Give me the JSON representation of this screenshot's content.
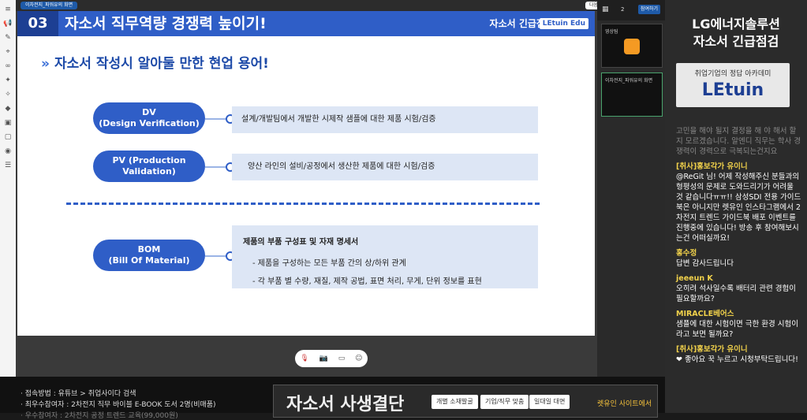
{
  "topbar": {
    "tab_label": "이차전지_파워유의 화면",
    "next_label": "다음"
  },
  "slide": {
    "num": "03",
    "title": "자소서 직무역량 경쟁력 높이기!",
    "right": "자소서 긴급점검",
    "logo": "LEtuin Edu",
    "subtitle": "자소서 작성시 알아둘 만한 현업 용어!",
    "items": [
      {
        "label_line1": "DV",
        "label_line2": "(Design Verification)",
        "desc": "설계/개발팀에서 개발한 시제작 샘플에 대한 제품 시험/검증"
      },
      {
        "label_line1": "PV (Production",
        "label_line2": "Validation)",
        "desc": "양산 라인의 설비/공정에서 생산한 제품에 대한 시험/검증"
      },
      {
        "label_line1": "BOM",
        "label_line2": "(Bill Of Material)",
        "desc_title": "제품의 부품 구성표 및 자재 명세서",
        "desc_1": "- 제품을 구성하는 모든 부품 간의 상/하위 관계",
        "desc_2": "- 각 부품 별 수량, 재질, 제작 공법, 표면 처리, 무게, 단위 정보를 표현"
      }
    ]
  },
  "participants": {
    "count": "2",
    "button": "참여하기",
    "tile1_name": "영상팀",
    "tile2_name": "이차전지_파워유의 화면"
  },
  "chat": {
    "title_1": "LG에너지솔루션",
    "title_2": "자소서 긴급점검",
    "logo_small": "취업기업의 정답 아카데미",
    "logo_big": "LEtuin",
    "messages": [
      {
        "user": "",
        "text": "고민을 해야 될지 결정을 해 야 해서 할지 모르겠습니다. 알엔디 직무는 학사 경쟁력이 경력으로 극복되는건지요"
      },
      {
        "user": "[취사]홍보각가 유이니",
        "text": "@ReGit 님! 어제 작성해주신 분들과의 형평성의 문제로 도와드리기가 어려울 것 같습니다ㅠㅠ!! 삼성SDI 전용 가이드북은 아니지만 렛유인 인스타그램에서 2차전지 트렌드 가이드북 배포 이벤트를 진행중에 있습니다! 방송 후 참여해보시는건 어떠실까요!"
      },
      {
        "user": "홍수정",
        "text": "답변 감사드립니다"
      },
      {
        "user": "jeeeun K",
        "text": "오히려 석사일수록 배터리 관련 경험이 필요할까요?"
      },
      {
        "user": "MIRACLE베어스",
        "text": "샘플에 대한 시험이면 극한 환경 시험이라고 보면 될까요?"
      },
      {
        "user": "[취사]홍보각가 유이니",
        "text": "❤ 좋아요 꾹 누르고 시청부탁드립니다!"
      }
    ]
  },
  "bottom": {
    "l1": "· 접속방법 : 유튜브 > 취업사이다 검색",
    "l2": "· 최우수참여자 : 2차전지 직무 바이블 E-BOOK 도서 2명(비매품)",
    "l3": "· 우수참여자 : 2차전지 공정 트렌드 교육(99,000원)",
    "banner_title": "자소서 사생결단",
    "b1": "개별 소재발굴",
    "b2": "기업/직무 맞춤",
    "b3": "일대일 대면",
    "site": "렛유인 사이트에서"
  }
}
